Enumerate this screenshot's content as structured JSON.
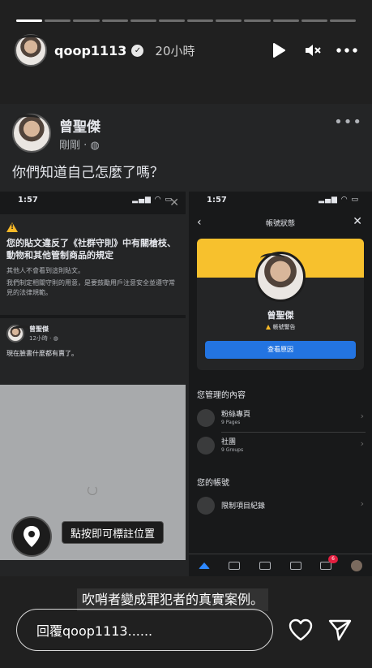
{
  "story": {
    "segments_total": 12,
    "segments_complete": 1,
    "username": "qoop1113",
    "time": "20小時",
    "reply_placeholder": "回覆qoop1113......",
    "caption": "吹哨者變成罪犯者的真實案例。"
  },
  "post": {
    "author": "曾聖傑",
    "meta": "剛剛 · ",
    "text": "你們知道自己怎麼了嗎？"
  },
  "left_shot": {
    "time": "1:57",
    "warning_title": "您的貼文違反了《社群守則》中有關槍枝、動物和其他管制商品的規定",
    "warning_sub": "其他人不會看到這則貼文。",
    "warning_desc": "我們制定相關守則的用意，是要鼓勵用戶注意安全並遵守常見的法律規範。",
    "mini_author": "曾聖傑",
    "mini_meta": "12小時 · ",
    "mini_text": "現在臉書什麼都有賣了。",
    "tag_label": "點按即可標註位置"
  },
  "right_shot": {
    "time": "1:57",
    "title": "帳號狀態",
    "name": "曾聖傑",
    "warning_label": "帳號警告",
    "button_label": "查看原因",
    "section_managed": "您管理的內容",
    "items": [
      {
        "label": "粉絲專頁",
        "sub": "9 Pages"
      },
      {
        "label": "社團",
        "sub": "9 Groups"
      }
    ],
    "section_account": "您的帳號",
    "restrict_label": "限制項目紀錄",
    "badge": "6"
  },
  "colors": {
    "warning_band": "#f7c12d",
    "button_blue": "#2374e1",
    "badge_red": "#e41e3f"
  }
}
